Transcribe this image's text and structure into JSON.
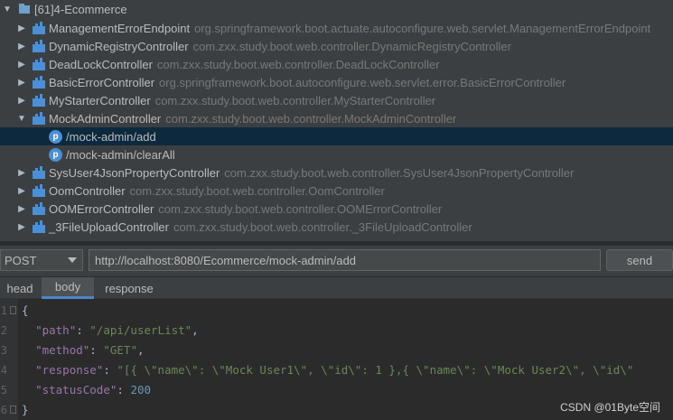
{
  "tree": {
    "root": {
      "label": "[61]4-Ecommerce"
    },
    "controllers": [
      {
        "name": "ManagementErrorEndpoint",
        "pkg": "org.springframework.boot.actuate.autoconfigure.web.servlet.ManagementErrorEndpoint"
      },
      {
        "name": "DynamicRegistryController",
        "pkg": "com.zxx.study.boot.web.controller.DynamicRegistryController"
      },
      {
        "name": "DeadLockController",
        "pkg": "com.zxx.study.boot.web.controller.DeadLockController"
      },
      {
        "name": "BasicErrorController",
        "pkg": "org.springframework.boot.autoconfigure.web.servlet.error.BasicErrorController"
      },
      {
        "name": "MyStarterController",
        "pkg": "com.zxx.study.boot.web.controller.MyStarterController"
      },
      {
        "name": "MockAdminController",
        "pkg": "com.zxx.study.boot.web.controller.MockAdminController"
      },
      {
        "name": "SysUser4JsonPropertyController",
        "pkg": "com.zxx.study.boot.web.controller.SysUser4JsonPropertyController"
      },
      {
        "name": "OomController",
        "pkg": "com.zxx.study.boot.web.controller.OomController"
      },
      {
        "name": "OOMErrorController",
        "pkg": "com.zxx.study.boot.web.controller.OOMErrorController"
      },
      {
        "name": "_3FileUploadController",
        "pkg": "com.zxx.study.boot.web.controller._3FileUploadController"
      }
    ],
    "endpoints": [
      {
        "icon": "p",
        "path": "/mock-admin/add"
      },
      {
        "icon": "p",
        "path": "/mock-admin/clearAll"
      }
    ]
  },
  "request": {
    "method": "POST",
    "url": "http://localhost:8080/Ecommerce/mock-admin/add",
    "send_label": "send"
  },
  "tabs": [
    "head",
    "body",
    "response"
  ],
  "editor": {
    "line_numbers": [
      "1",
      "2",
      "3",
      "4",
      "5",
      "6"
    ],
    "lines": [
      {
        "punct": "{"
      },
      {
        "key": "\"path\"",
        "sep": ": ",
        "value": "\"/api/userList\"",
        "tail": ","
      },
      {
        "key": "\"method\"",
        "sep": ": ",
        "value": "\"GET\"",
        "tail": ","
      },
      {
        "key": "\"response\"",
        "sep": ": ",
        "value": "\"[{ \\\"name\\\": \\\"Mock User1\\\", \\\"id\\\": 1 },{ \\\"name\\\": \\\"Mock User2\\\", \\\"id\\\"",
        "tail": ""
      },
      {
        "key": "\"statusCode\"",
        "sep": ": ",
        "number": "200"
      },
      {
        "punct": "}"
      }
    ]
  },
  "watermark": "CSDN @01Byte空间",
  "colors": {
    "selected_row": "#0d293e",
    "endpoint_icon": "#4d8fd6",
    "json_key": "#9876aa",
    "json_string": "#6a8759",
    "json_number": "#6897bb"
  }
}
